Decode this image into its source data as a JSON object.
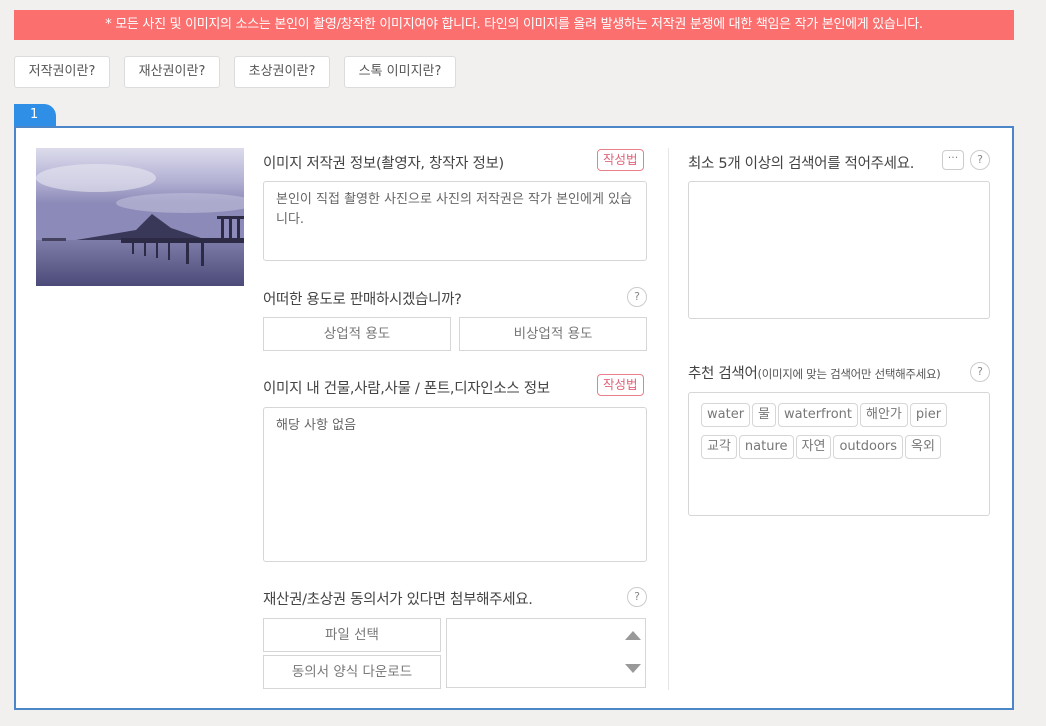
{
  "notice": "* 모든 사진 및 이미지의 소스는 본인이 촬영/창작한 이미지여야 합니다. 타인의 이미지를 올려 발생하는 저작권 분쟁에 대한 책임은 작가 본인에게 있습니다.",
  "info_buttons": [
    "저작권이란?",
    "재산권이란?",
    "초상권이란?",
    "스톡 이미지란?"
  ],
  "item_number": "1",
  "colors": {
    "notice_bg": "#fb6f6f",
    "accent_blue": "#2f8ee6",
    "panel_border": "#4a86c8",
    "howto_red": "#e0647a"
  },
  "copyright": {
    "label": "이미지 저작권 정보(촬영자, 창작자 정보)",
    "howto": "작성법",
    "value": "본인이 직접 촬영한 사진으로 사진의 저작권은 작가 본인에게 있습니다."
  },
  "usage": {
    "label": "어떠한 용도로 판매하시겠습니까?",
    "help": "?",
    "options": [
      "상업적 용도",
      "비상업적 용도"
    ]
  },
  "sources": {
    "label": "이미지 내 건물,사람,사물 / 폰트,디자인소스 정보",
    "howto": "작성법",
    "value": "해당 사항 없음"
  },
  "consent": {
    "label": "재산권/초상권 동의서가 있다면 첨부해주세요.",
    "help": "?",
    "file_button": "파일 선택",
    "download_button": "동의서 양식 다운로드"
  },
  "keywords": {
    "label": "최소 5개 이상의 검색어를 적어주세요.",
    "more": "···",
    "help": "?",
    "value": ""
  },
  "recommended": {
    "label": "추천 검색어",
    "sublabel": "(이미지에 맞는 검색어만 선택해주세요)",
    "help": "?",
    "tags": [
      "water",
      "물",
      "waterfront",
      "해안가",
      "pier",
      "교각",
      "nature",
      "자연",
      "outdoors",
      "옥외"
    ]
  },
  "thumbnail": {
    "alt": "pier-and-mountain-photo"
  }
}
